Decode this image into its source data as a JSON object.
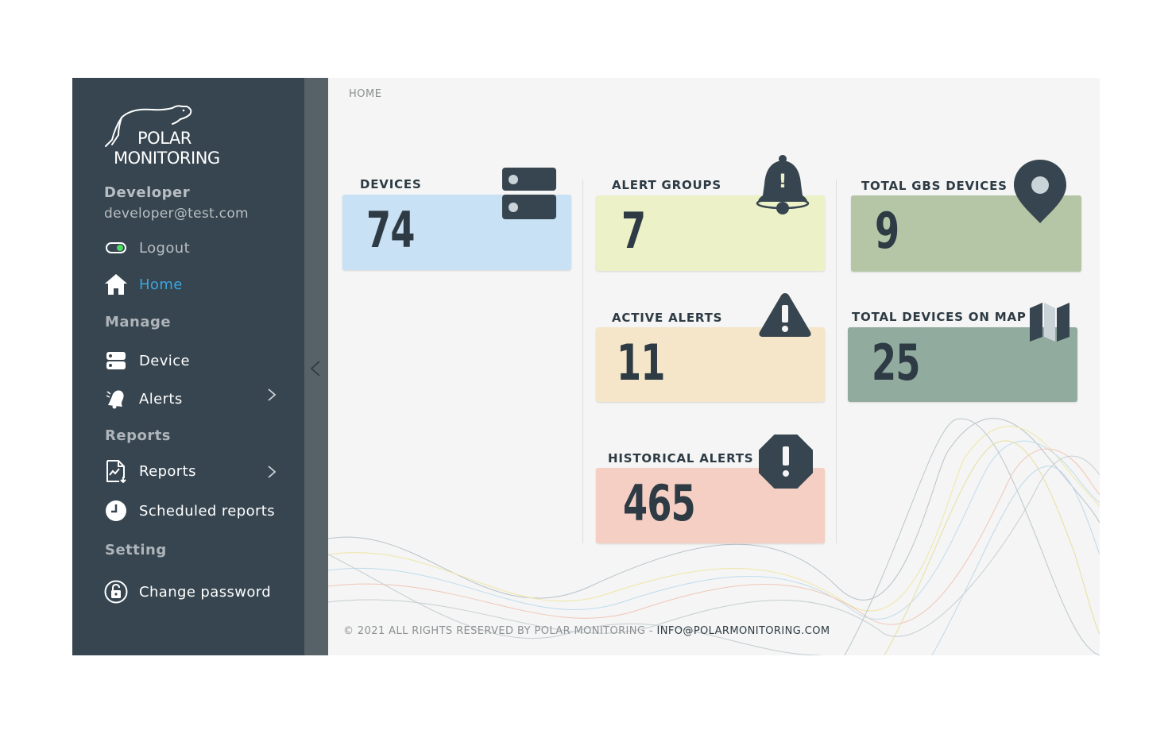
{
  "brand": {
    "line1": "POLAR",
    "line2": "MONITORING"
  },
  "user": {
    "name": "Developer",
    "email": "developer@test.com"
  },
  "nav": {
    "logout": "Logout",
    "home": "Home",
    "manage_header": "Manage",
    "device": "Device",
    "alerts": "Alerts",
    "reports_header": "Reports",
    "reports": "Reports",
    "scheduled_reports": "Scheduled reports",
    "setting_header": "Setting",
    "change_password": "Change password"
  },
  "breadcrumb": "HOME",
  "cards": {
    "devices": {
      "label": "DEVICES",
      "value": "74",
      "color": "#c9e1f4",
      "icon": "server-icon"
    },
    "alert_groups": {
      "label": "ALERT GROUPS",
      "value": "7",
      "color": "#ecf1c7",
      "icon": "bell-icon"
    },
    "total_gbs": {
      "label": "TOTAL GBS DEVICES",
      "value": "9",
      "color": "#b5c6a7",
      "icon": "map-pin-icon"
    },
    "active_alerts": {
      "label": "ACTIVE ALERTS",
      "value": "11",
      "color": "#f5e5c9",
      "icon": "warning-icon"
    },
    "devices_on_map": {
      "label": "TOTAL DEVICES ON MAP",
      "value": "25",
      "color": "#91ab9f",
      "icon": "map-icon"
    },
    "historical_alerts": {
      "label": "HISTORICAL ALERTS",
      "value": "465",
      "color": "#f5cfc3",
      "icon": "octagon-alert-icon"
    }
  },
  "footer": {
    "copyright": "© 2021 ALL RIGHTS RESERVED BY POLAR MONITORING - ",
    "email": "INFO@POLARMONITORING.COM"
  },
  "colors": {
    "sidebar": "#36454f",
    "active_nav": "#3aa6e0",
    "text_dark": "#2e3b44"
  }
}
